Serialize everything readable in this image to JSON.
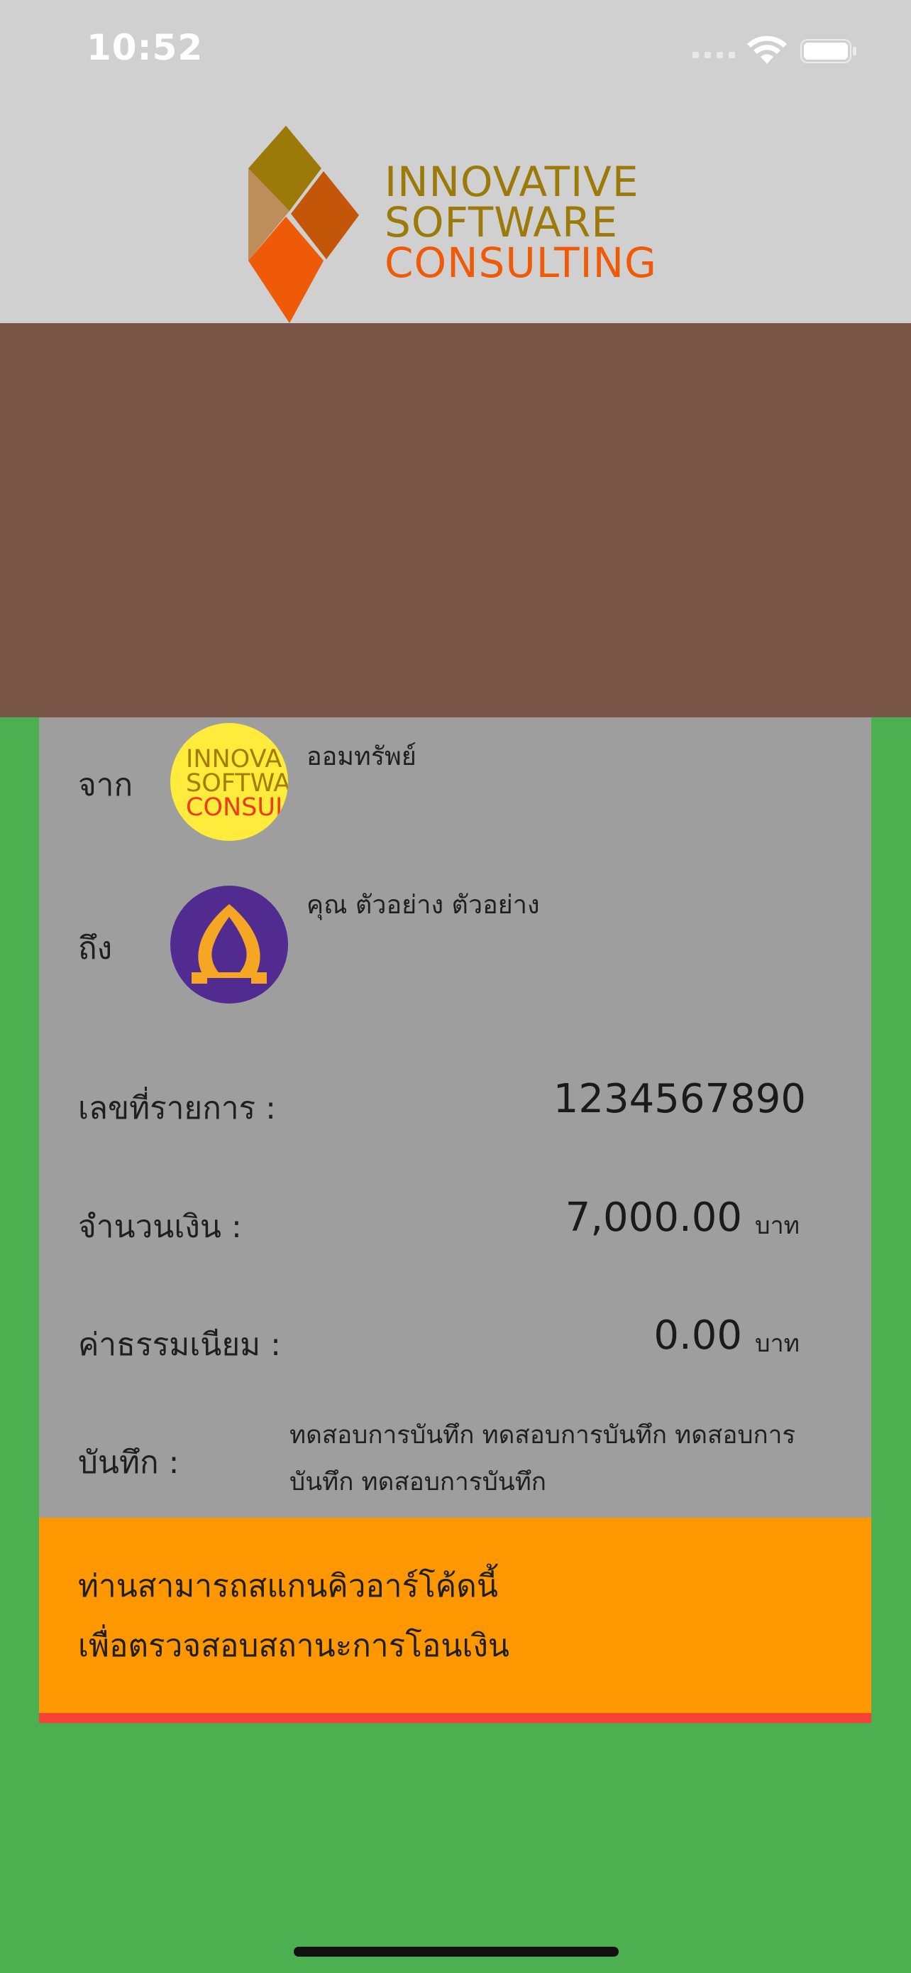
{
  "status_bar": {
    "time": "10:52",
    "icons": [
      "signal-icon",
      "wifi-icon",
      "battery-icon"
    ]
  },
  "header": {
    "brand_lines": [
      "INNOVATIVE",
      "SOFTWARE",
      "CONSULTING"
    ],
    "colors": {
      "brand_gold": "#9b7a0a",
      "brand_orange": "#ef5a08",
      "header_bg": "#d0d0d0"
    }
  },
  "banner": {
    "color": "#795548"
  },
  "transfer": {
    "from_label": "จาก",
    "from_name": "ออมทรัพย์",
    "from_avatar_lines": [
      "INNOVA",
      "SOFTWA",
      "CONSUL"
    ],
    "to_label": "ถึง",
    "to_name": "คุณ ตัวอย่าง ตัวอย่าง",
    "to_avatar_icon": "bank-leaf-icon",
    "ref_label": "เลขที่รายการ :",
    "ref_value": "1234567890",
    "amount_label": "จำนวนเงิน :",
    "amount_value": "7,000.00",
    "amount_unit": "บาท",
    "fee_label": "ค่าธรรมเนียม :",
    "fee_value": "0.00",
    "fee_unit": "บาท",
    "note_label": "บันทึก :",
    "note_lines": [
      "ทดสอบการบันทึก ทดสอบการบันทึก ทดสอบการ",
      "บันทึก ทดสอบการบันทึก"
    ]
  },
  "notice": {
    "line1": "ท่านสามารถสแกนคิวอาร์โค้ดนี้",
    "line2": "เพื่อตรวจสอบสถานะการโอนเงิน",
    "colors": {
      "bg": "#ff9800",
      "bar": "#f44336"
    }
  },
  "page": {
    "background": "#4caf50"
  }
}
